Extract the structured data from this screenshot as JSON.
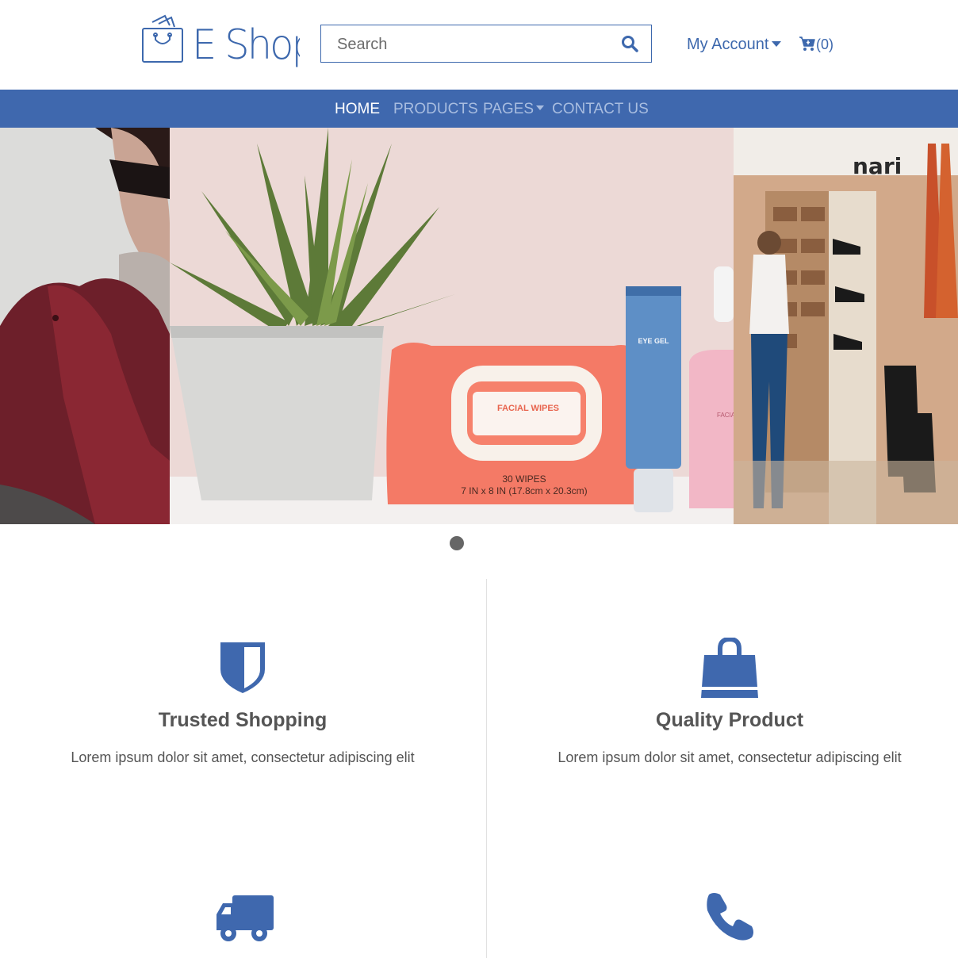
{
  "brand": {
    "name": "E Shop"
  },
  "search": {
    "placeholder": "Search"
  },
  "header": {
    "account_label": "My Account",
    "cart_count": "(0)"
  },
  "nav": {
    "items": [
      {
        "label": "HOME"
      },
      {
        "label": "PRODUCTS"
      },
      {
        "label": "PAGES"
      },
      {
        "label": "CONTACT US"
      }
    ]
  },
  "carousel": {
    "slides": [
      {
        "label": "woman-in-red-coat"
      },
      {
        "label": "plant-and-facial-products"
      },
      {
        "label": "shoe-store"
      }
    ]
  },
  "product": {
    "wipes_label": "FACIAL WIPES",
    "wipes_count": "30 WIPES",
    "wipes_size": "7 IN x 8 IN (17.8cm x 20.3cm)",
    "tube_label": "EYE GEL",
    "spray_label": "FACIAL SPRAY",
    "store_sign": "nari"
  },
  "features": [
    {
      "title": "Trusted Shopping",
      "text": "Lorem ipsum dolor sit amet, consectetur adipiscing elit",
      "icon": "shield-icon"
    },
    {
      "title": "Quality Product",
      "text": "Lorem ipsum dolor sit amet, consectetur adipiscing elit",
      "icon": "shopping-bag-icon"
    },
    {
      "icon": "truck-icon"
    },
    {
      "icon": "phone-icon"
    }
  ],
  "colors": {
    "brand": "#3f68ae",
    "text": "#555555"
  }
}
